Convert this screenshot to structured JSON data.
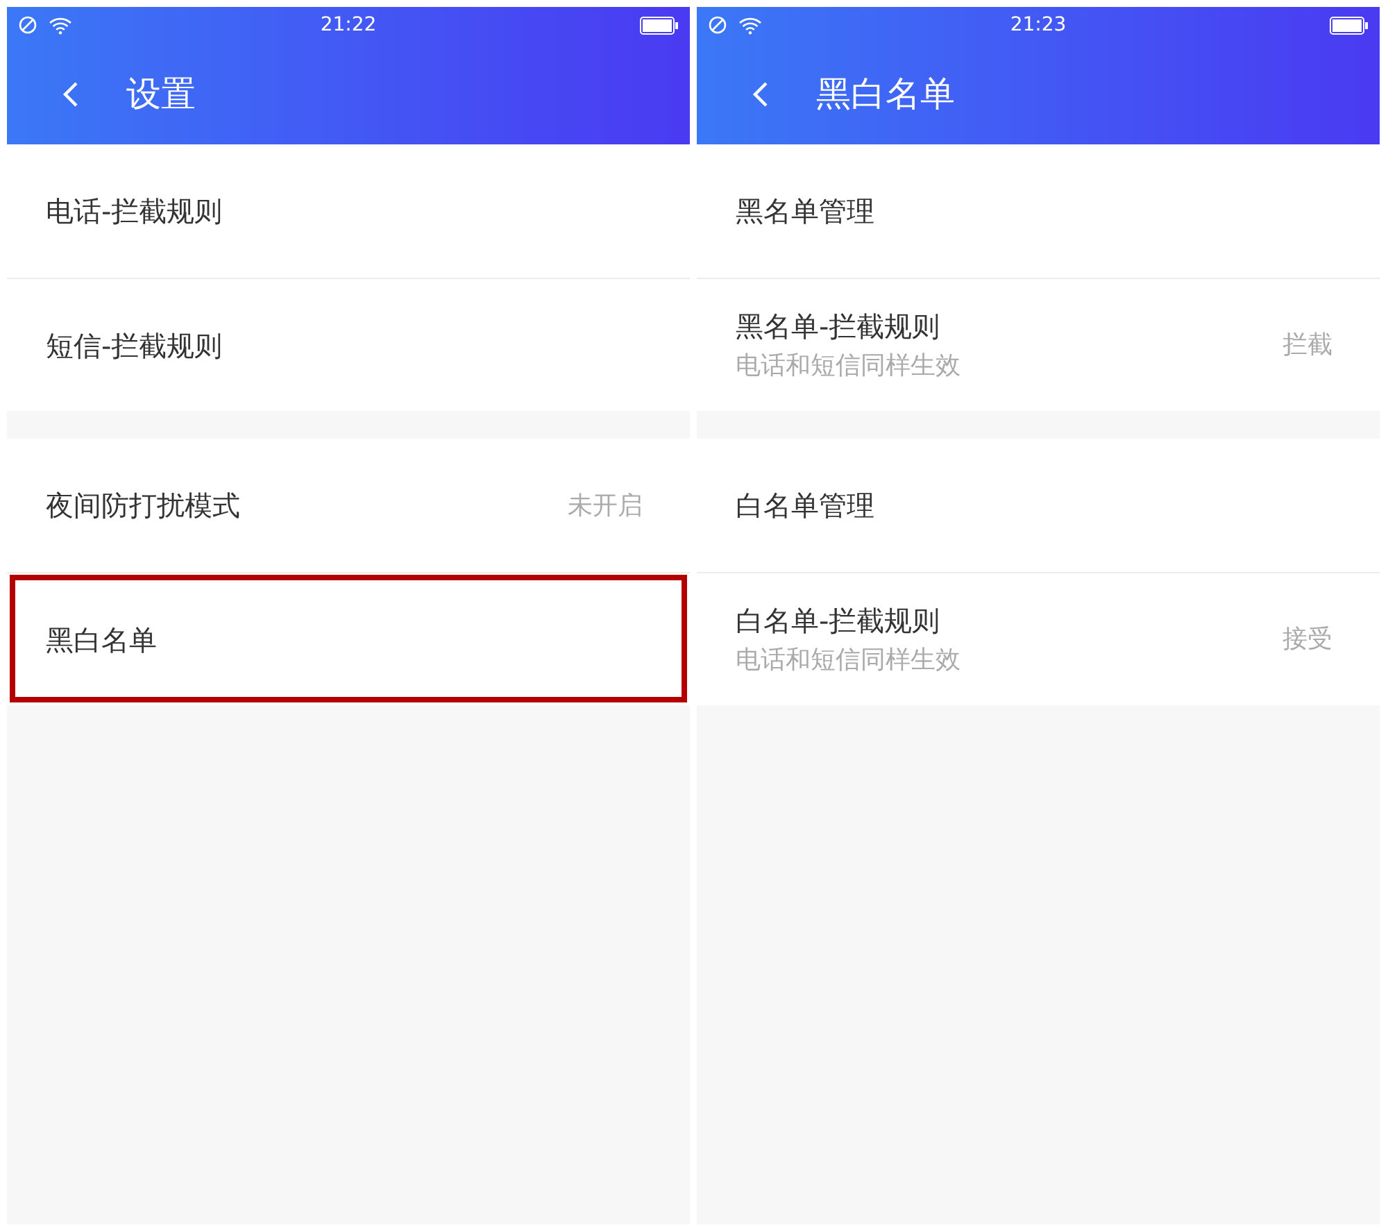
{
  "screens": [
    {
      "status_bar": {
        "time": "21:22"
      },
      "title": "设置",
      "groups": [
        [
          {
            "label": "电话-拦截规则",
            "highlighted": false
          },
          {
            "label": "短信-拦截规则",
            "highlighted": false
          }
        ],
        [
          {
            "label": "夜间防打扰模式",
            "value": "未开启",
            "highlighted": false
          },
          {
            "label": "黑白名单",
            "highlighted": true
          }
        ]
      ]
    },
    {
      "status_bar": {
        "time": "21:23"
      },
      "title": "黑白名单",
      "groups": [
        [
          {
            "label": "黑名单管理",
            "highlighted": false
          },
          {
            "label": "黑名单-拦截规则",
            "subtitle": "电话和短信同样生效",
            "value": "拦截",
            "highlighted": false
          }
        ],
        [
          {
            "label": "白名单管理",
            "highlighted": false
          },
          {
            "label": "白名单-拦截规则",
            "subtitle": "电话和短信同样生效",
            "value": "接受",
            "highlighted": false
          }
        ]
      ]
    }
  ]
}
